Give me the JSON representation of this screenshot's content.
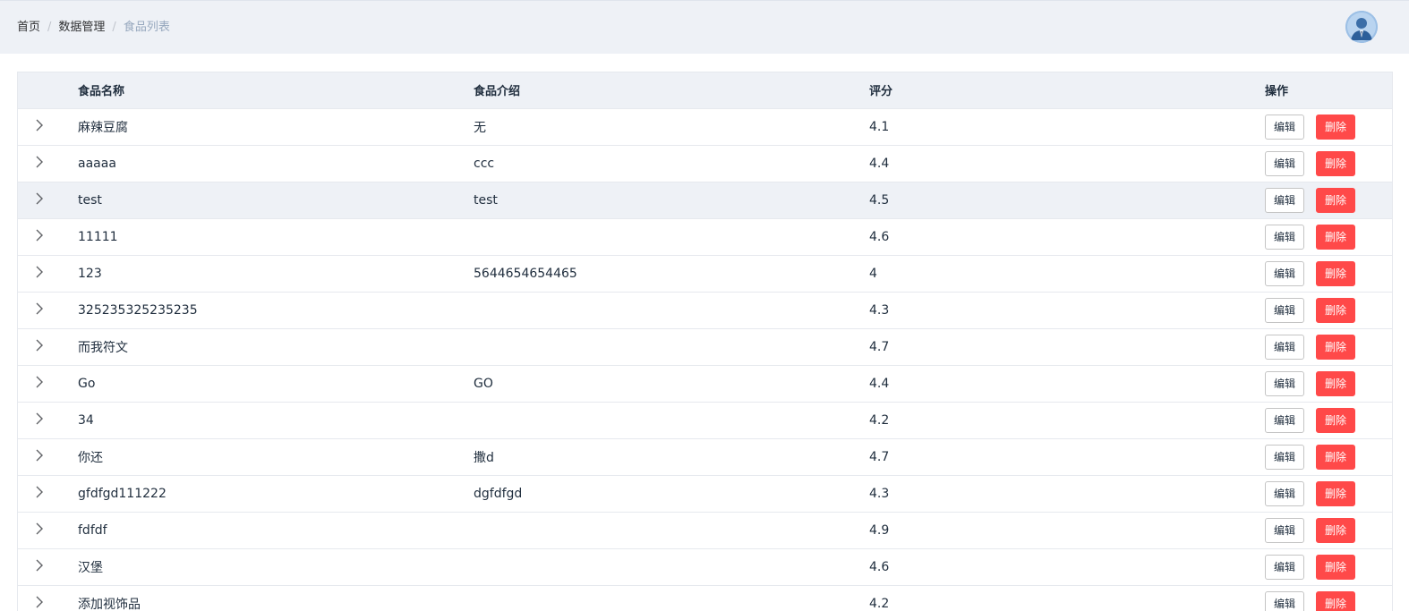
{
  "breadcrumb": {
    "home": "首页",
    "data_manage": "数据管理",
    "current": "食品列表"
  },
  "table": {
    "columns": {
      "name": "食品名称",
      "desc": "食品介绍",
      "score": "评分",
      "ops": "操作"
    },
    "edit_label": "编辑",
    "delete_label": "删除",
    "rows": [
      {
        "name": "麻辣豆腐",
        "desc": "无",
        "score": "4.1"
      },
      {
        "name": "aaaaa",
        "desc": "ccc",
        "score": "4.4"
      },
      {
        "name": "test",
        "desc": "test",
        "score": "4.5"
      },
      {
        "name": "11111",
        "desc": "",
        "score": "4.6"
      },
      {
        "name": "123",
        "desc": "5644654654465",
        "score": "4"
      },
      {
        "name": "325235325235235",
        "desc": "",
        "score": "4.3"
      },
      {
        "name": "而我符文",
        "desc": "",
        "score": "4.7"
      },
      {
        "name": "Go",
        "desc": "GO",
        "score": "4.4"
      },
      {
        "name": "34",
        "desc": "",
        "score": "4.2"
      },
      {
        "name": "你还",
        "desc": "撒d",
        "score": "4.7"
      },
      {
        "name": "gfdfgd111222",
        "desc": "dgfdfgd",
        "score": "4.3"
      },
      {
        "name": "fdfdf",
        "desc": "",
        "score": "4.9"
      },
      {
        "name": "汉堡",
        "desc": "",
        "score": "4.6"
      },
      {
        "name": "添加视饰品",
        "desc": "",
        "score": "4.2"
      }
    ]
  },
  "colors": {
    "header_bg": "#eef1f6",
    "delete_button": "#ff4949",
    "border": "#e6e9ee"
  },
  "icons": {
    "expand": "chevron-right-icon",
    "avatar": "user-avatar-icon"
  }
}
